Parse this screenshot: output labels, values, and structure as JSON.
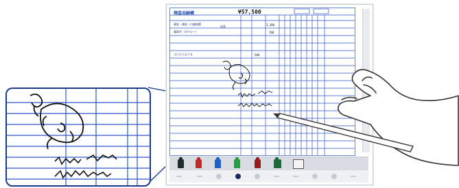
{
  "ledger": {
    "title": "現金出納帳",
    "amount": "¥57,500",
    "rows": [
      {
        "label": "現金・預金・口座振替",
        "sub": "出金",
        "num": "3,300"
      },
      {
        "label": "電車代（タクシー）",
        "sub": "",
        "num": "700"
      },
      {
        "label": "",
        "sub": "",
        "num": ""
      },
      {
        "label": "コンビニエンス",
        "sub": "",
        "num": "500"
      }
    ]
  },
  "handwriting": {
    "line1": "昼飲み会 /～/600",
    "line2": "会 食費員 /1円"
  },
  "toolbar": {
    "pens": [
      {
        "name": "black-pen",
        "color": "#1f2a2a"
      },
      {
        "name": "red-pen",
        "color": "#c8262b"
      },
      {
        "name": "blue-pen",
        "color": "#1f5fc7"
      },
      {
        "name": "green-pen",
        "color": "#2a9a45"
      },
      {
        "name": "dark-red-pen",
        "color": "#9a1a1e"
      },
      {
        "name": "dark-green-pen",
        "color": "#1e6a3a"
      }
    ],
    "tools": [
      "eraser-icon",
      "frame-icon"
    ]
  },
  "colors": {
    "ledger_lines": "#2d55c6",
    "callout_border": "#1a3a8a",
    "ink": "#111111"
  }
}
